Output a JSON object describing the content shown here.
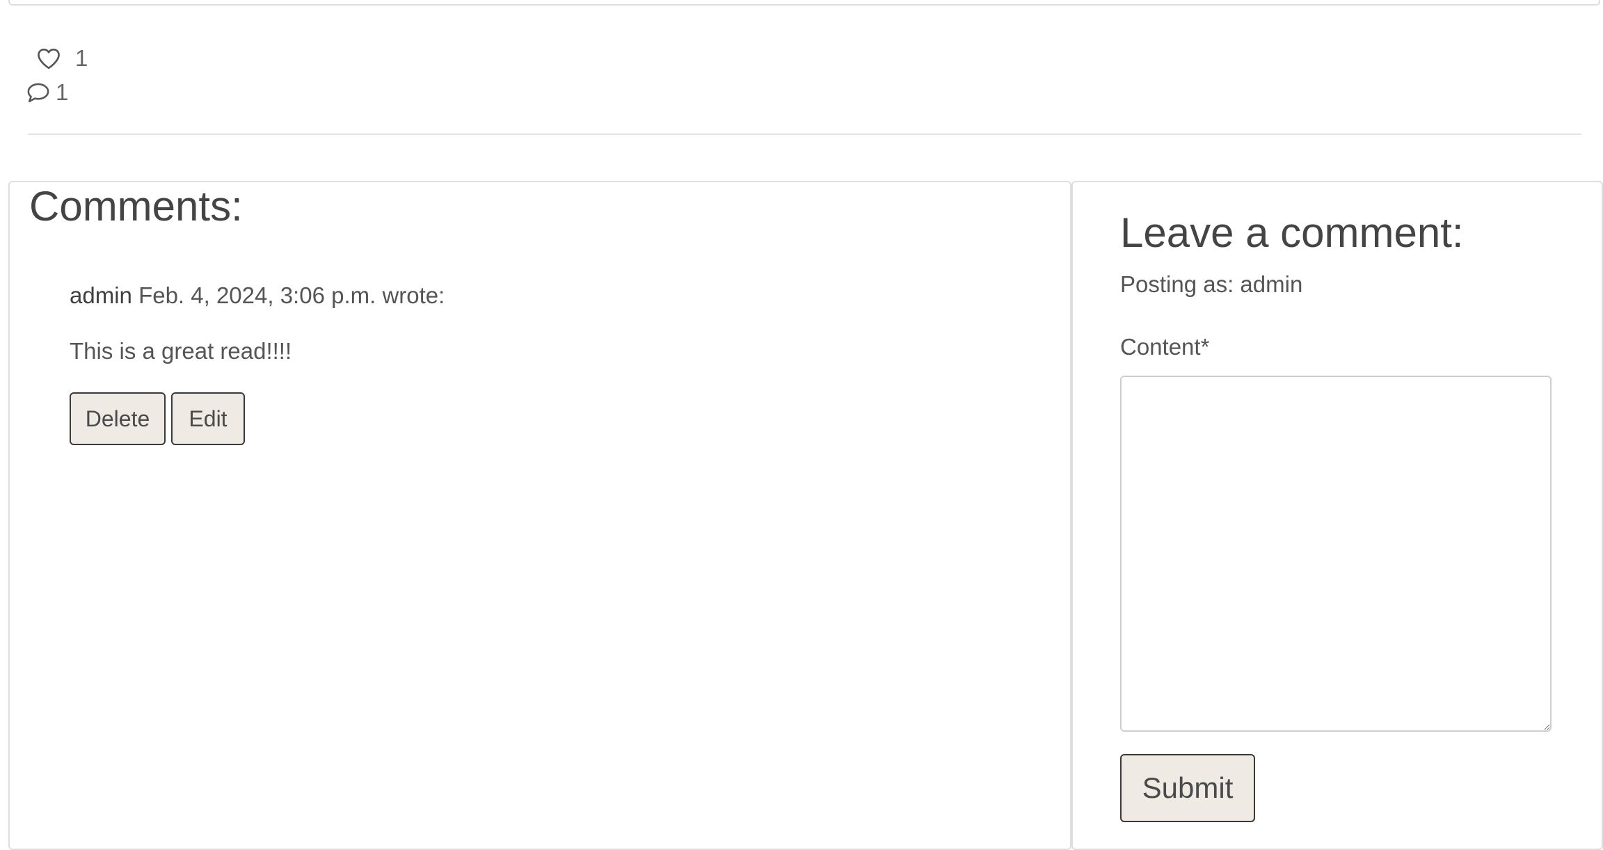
{
  "post_stats": {
    "like_icon": "heart-icon",
    "likes_count": "1",
    "comment_icon": "speech-bubble-icon",
    "comments_count": "1"
  },
  "comments_section": {
    "title": "Comments:",
    "comments": [
      {
        "author": "admin",
        "date": "Feb. 4, 2024, 3:06 p.m.",
        "wrote": "wrote:",
        "body": "This is a great read!!!!",
        "delete_label": "Delete",
        "edit_label": "Edit"
      }
    ]
  },
  "comment_form": {
    "title": "Leave a comment:",
    "posting_as": "Posting as: admin",
    "content_label": "Content*",
    "content_value": "",
    "submit_label": "Submit"
  },
  "colors": {
    "button_bg": "#efebe4",
    "button_border": "#3a3a3a",
    "card_border": "#dedede"
  }
}
